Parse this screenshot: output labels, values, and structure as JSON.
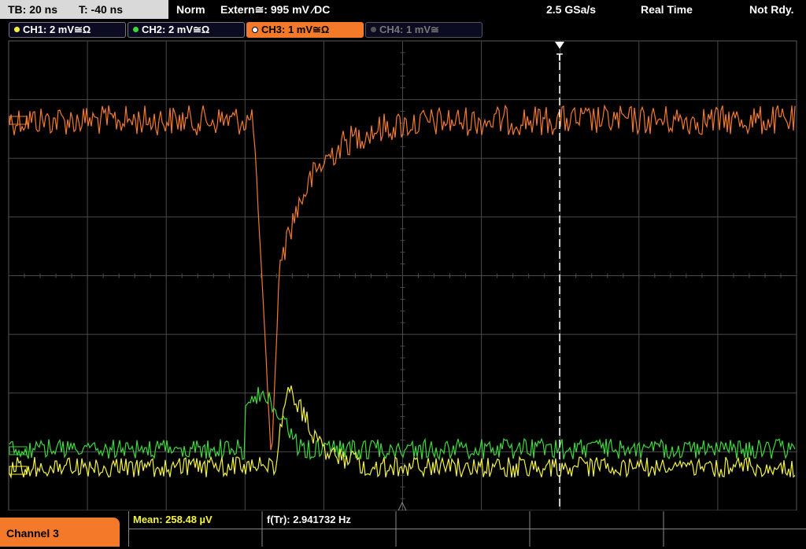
{
  "top_bar": {
    "timebase": "TB: 20 ns",
    "trigger_time": "T: -40 ns",
    "trigger_mode": "Norm",
    "trigger_source": "Extern≅: 995 mV ⁄DC",
    "sample_rate": "2.5 GSa/s",
    "acq_mode": "Real Time",
    "status": "Not Rdy."
  },
  "channels": [
    {
      "label": "CH1: 2 mV≅Ω",
      "color": "#f4f43c",
      "state": "on"
    },
    {
      "label": "CH2: 2 mV≅Ω",
      "color": "#3cd93c",
      "state": "on"
    },
    {
      "label": "CH3: 1 mV≅Ω",
      "color": "#f47a2a",
      "state": "selected"
    },
    {
      "label": "CH4: 1 mV≅",
      "color": "#777777",
      "state": "off"
    }
  ],
  "trigger_marker": "T",
  "bottom": {
    "active_channel": "Channel 3",
    "mean": "Mean: 258.48 µV",
    "frequency": "f(Tr): 2.941732 Hz"
  },
  "colors": {
    "ch1": "#f4f43c",
    "ch2": "#3cd93c",
    "ch3": "#f47a2a",
    "grid": "#4a4a4a"
  }
}
